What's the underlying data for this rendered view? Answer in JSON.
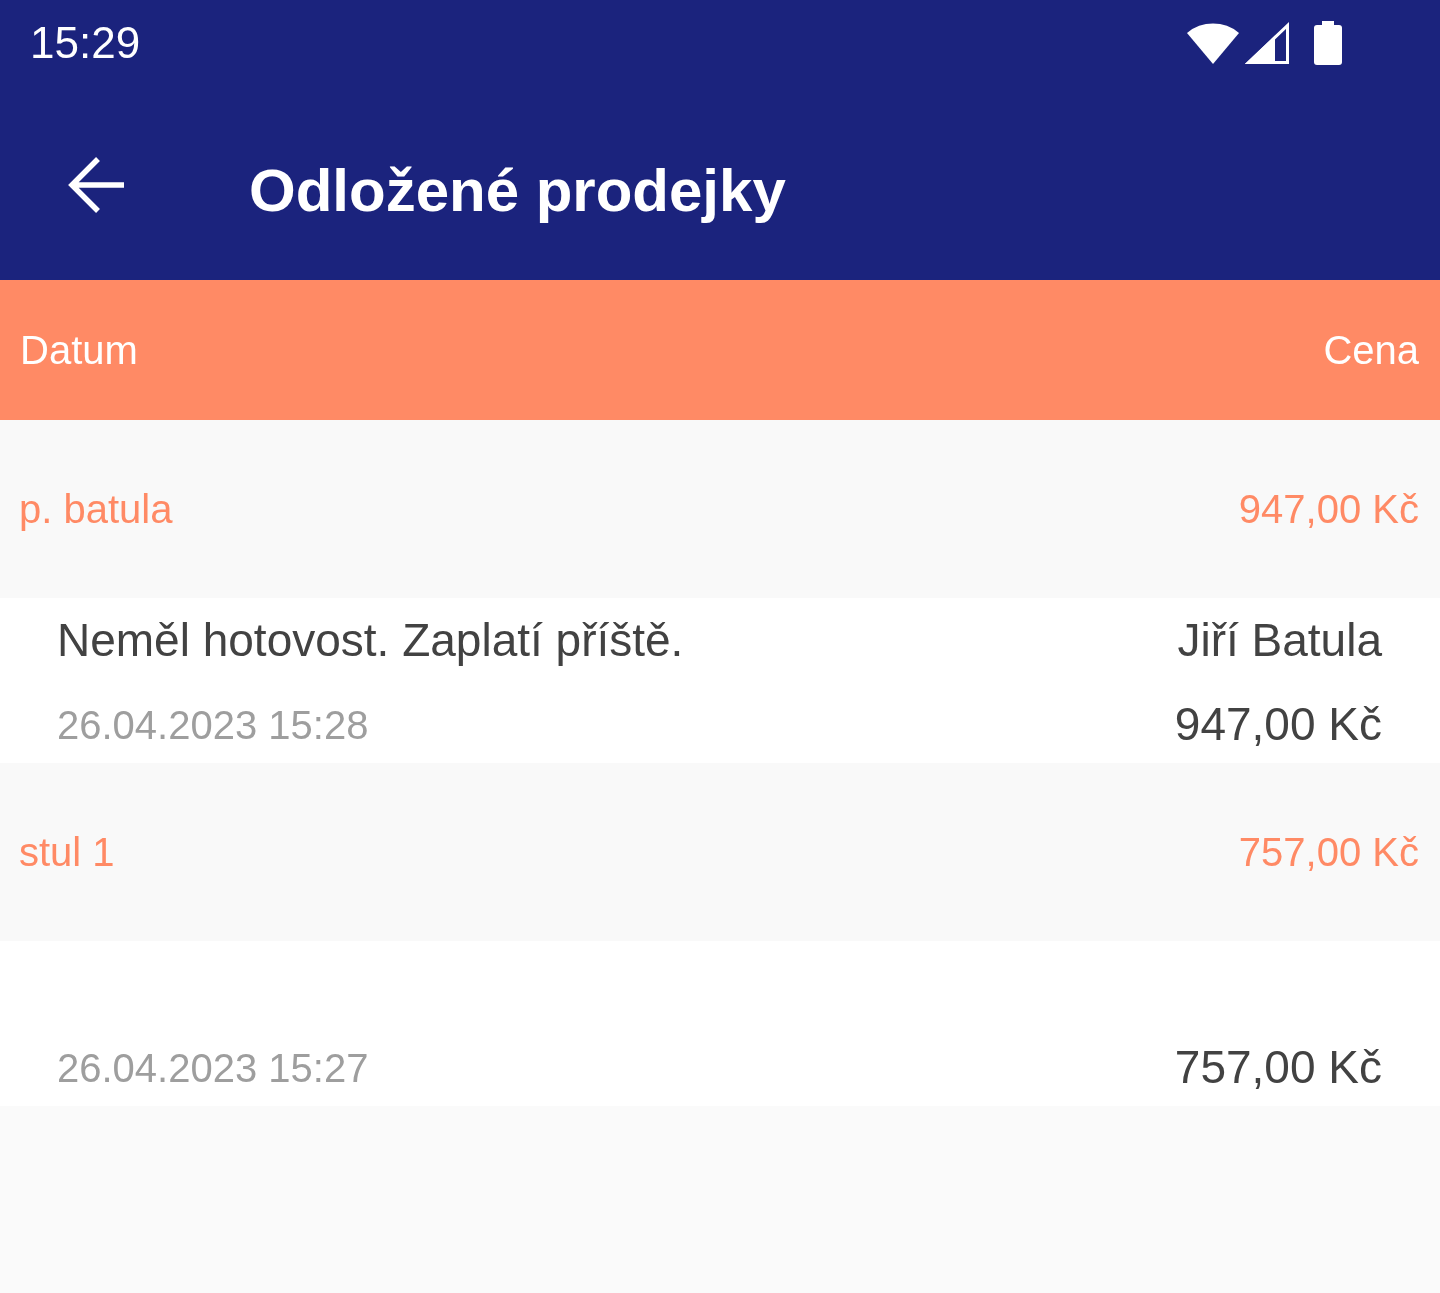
{
  "status_bar": {
    "time": "15:29"
  },
  "app_bar": {
    "title": "Odložené prodejky"
  },
  "table": {
    "columns": [
      "Datum",
      "Cena"
    ],
    "groups": [
      {
        "name": "p. batula",
        "total": "947,00 Kč",
        "receipts": [
          {
            "note": "Neměl hotovost. Zaplatí příště.",
            "customer": "Jiří Batula",
            "date": "26.04.2023 15:28",
            "price": "947,00 Kč"
          }
        ]
      },
      {
        "name": "stul 1",
        "total": "757,00 Kč",
        "receipts": [
          {
            "date": "26.04.2023 15:27",
            "price": "757,00 Kč"
          }
        ]
      }
    ]
  }
}
